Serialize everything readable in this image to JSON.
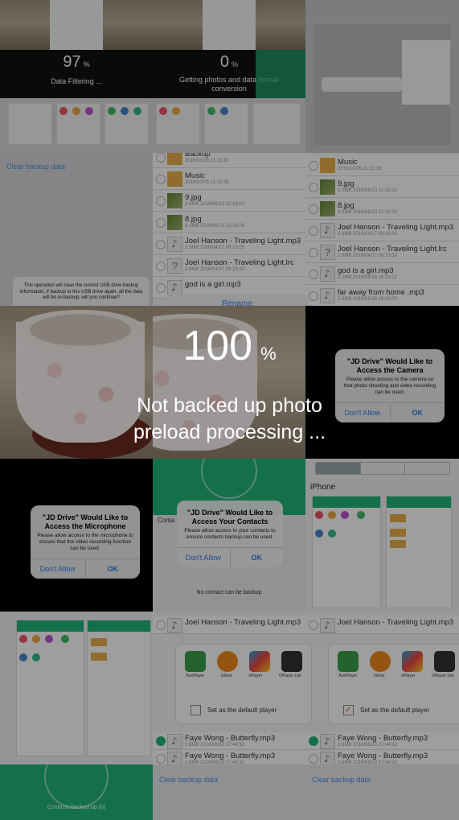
{
  "progress": {
    "filtering": {
      "value": "97",
      "unit": "%",
      "label": "Data Filtering ..."
    },
    "converting": {
      "value": "0",
      "unit": "%",
      "label": "Getting photos and data format conversion"
    }
  },
  "backup": {
    "clear_link": "Clear backup data",
    "clear_message": "This operation will clear the current USB drive backup information, if backup to this USB drive again, all the data will be re-backup, will you continue?",
    "rename_button": "Rename"
  },
  "files": {
    "list_a": [
      {
        "name": "Backup",
        "meta": "2016/01/05 11:23:36",
        "type": "folder"
      },
      {
        "name": "Music",
        "meta": "2016/10/05 11:23:36",
        "type": "folder"
      },
      {
        "name": "9.jpg",
        "meta": "2.0MB 2016/06/13 12:16:02",
        "type": "image"
      },
      {
        "name": "8.jpg",
        "meta": "4.2MB 2016/06/13 12:16:04",
        "type": "image"
      },
      {
        "name": "Joel Hanson - Traveling Light.mp3",
        "meta": "2.3MB 2016/04/27 09:18:05",
        "type": "audio"
      },
      {
        "name": "Joel Hanson - Traveling Light.lrc",
        "meta": "2.6MB 2016/04/27 09:18:10",
        "type": "unknown"
      },
      {
        "name": "god is a girl.mp3",
        "meta": "",
        "type": "audio"
      }
    ],
    "list_b": [
      {
        "name": "Music",
        "meta": "2016/10/05 11:23:36",
        "type": "folder"
      },
      {
        "name": "9.jpg",
        "meta": "2.0MB 2016/06/13 12:16:02",
        "type": "image"
      },
      {
        "name": "8.jpg",
        "meta": "4.2MB 2016/06/13 12:16:04",
        "type": "image"
      },
      {
        "name": "Joel Hanson - Traveling Light.mp3",
        "meta": "2.3MB 2016/04/27 09:18:05",
        "type": "audio"
      },
      {
        "name": "Joel Hanson - Traveling Light.lrc",
        "meta": "2.6MB 2016/04/27 09:18:10",
        "type": "unknown"
      },
      {
        "name": "god is a girl.mp3",
        "meta": "3.2MB 2016/06/18 16:02:02",
        "type": "audio"
      },
      {
        "name": "far away from home .mp3",
        "meta": "5.3MB 2016/06/18 16:02:00",
        "type": "audio"
      }
    ]
  },
  "center": {
    "percent": "100",
    "unit": "%",
    "message": "Not backed up photo preload processing ..."
  },
  "alerts": {
    "camera": {
      "title": "\"JD Drive\" Would Like to Access the Camera",
      "message": "Please allow access to the camera so that photo shooting and video recording can be used.",
      "deny": "Don't Allow",
      "ok": "OK"
    },
    "microphone": {
      "title": "\"JD Drive\" Would Like to Access the Microphone",
      "message": "Please allow access to the microphone to ensure that the video recording function can be used.",
      "deny": "Don't Allow",
      "ok": "OK"
    },
    "contacts": {
      "title": "\"JD Drive\" Would Like to Access Your Contacts",
      "message": "Please allow access to your contacts to ensure contacts backup can be used.",
      "deny": "Don't Allow",
      "ok": "OK"
    }
  },
  "contacts": {
    "empty_message": "No contact can be backup",
    "backed_up_label": "Contacts backed up (0)",
    "contact_tab_label": "Conta"
  },
  "device": {
    "name": "iPhone"
  },
  "player": {
    "apps": [
      "AcePlayer",
      "Infuse",
      "nPlayer",
      "OPlayer Lite"
    ],
    "default_label": "Set as the default player",
    "files": [
      {
        "name": "Joel Hanson - Traveling Light.mp3",
        "meta": ""
      },
      {
        "name": "Faye Wong - Butterfly.mp3",
        "meta": "3.6MB 2016/06/23 17:44:32"
      },
      {
        "name": "Faye Wong - Butterfly.mp3",
        "meta": "3.6MB 2016/06/23 17:44:32"
      }
    ]
  },
  "colors": {
    "brand_green": "#21b57a",
    "ios_blue": "#2a7be4",
    "folder": "#e8b04b"
  }
}
